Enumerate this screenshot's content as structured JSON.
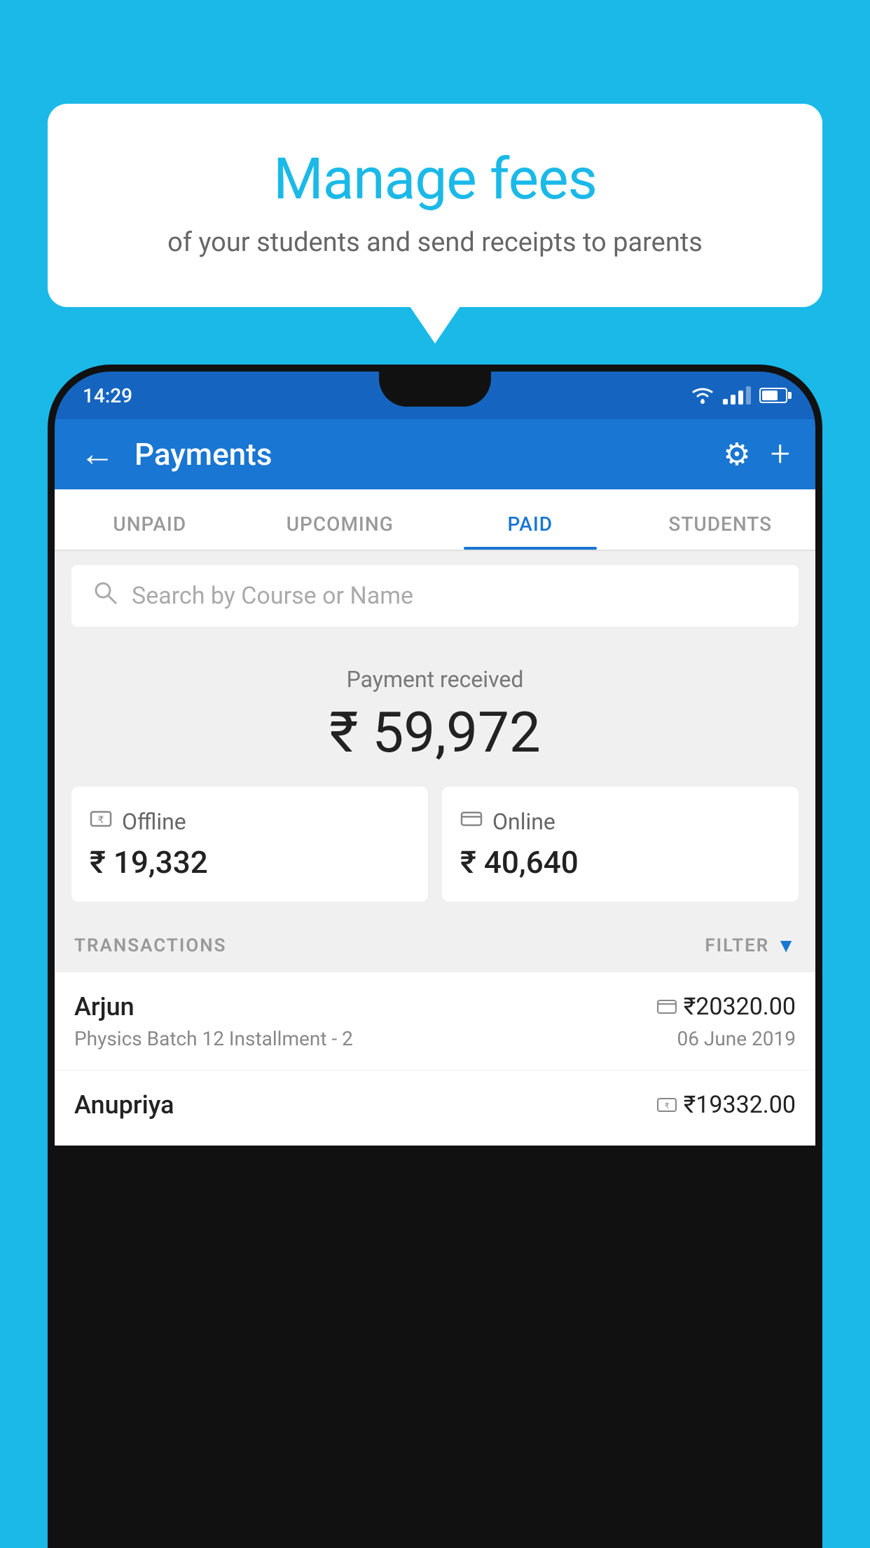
{
  "hero": {
    "title": "Manage fees",
    "subtitle": "of your students and send receipts to parents"
  },
  "statusBar": {
    "time": "14:29",
    "wifi": "wifi",
    "signal": "signal",
    "battery": "battery"
  },
  "appBar": {
    "title": "Payments",
    "backIcon": "←",
    "gearIcon": "⚙",
    "plusIcon": "+"
  },
  "tabs": [
    {
      "label": "UNPAID",
      "active": false
    },
    {
      "label": "UPCOMING",
      "active": false
    },
    {
      "label": "PAID",
      "active": true
    },
    {
      "label": "STUDENTS",
      "active": false
    }
  ],
  "search": {
    "placeholder": "Search by Course or Name"
  },
  "paymentSummary": {
    "label": "Payment received",
    "amount": "₹ 59,972",
    "offline": {
      "type": "Offline",
      "amount": "₹ 19,332"
    },
    "online": {
      "type": "Online",
      "amount": "₹ 40,640"
    }
  },
  "transactions": {
    "sectionLabel": "TRANSACTIONS",
    "filterLabel": "FILTER",
    "rows": [
      {
        "name": "Arjun",
        "amountIcon": "card",
        "amount": "₹20320.00",
        "course": "Physics Batch 12 Installment - 2",
        "date": "06 June 2019"
      },
      {
        "name": "Anupriya",
        "amountIcon": "cash",
        "amount": "₹19332.00",
        "course": "",
        "date": ""
      }
    ]
  },
  "colors": {
    "primary": "#1976d2",
    "background": "#1ab9e8",
    "accent": "#1ab9e8"
  }
}
